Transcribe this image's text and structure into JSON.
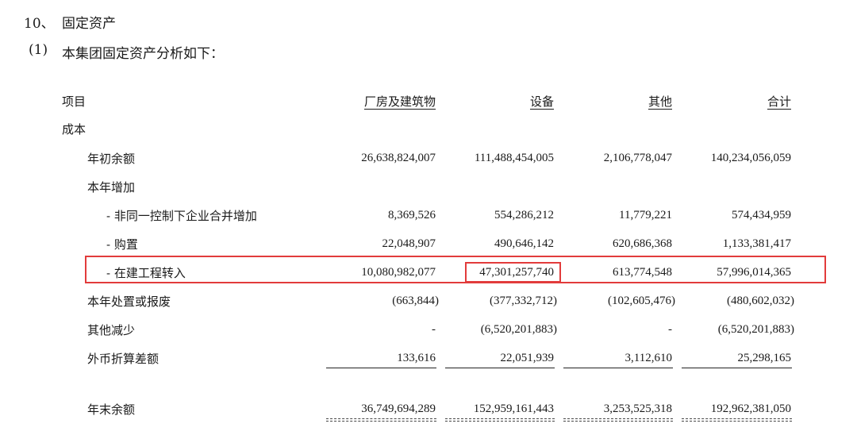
{
  "section": {
    "number": "10、",
    "title": "固定资产",
    "sub_number": "(1)",
    "sub_title": "本集团固定资产分析如下："
  },
  "table": {
    "headers": {
      "item": "项目",
      "col1": "厂房及建筑物",
      "col2": "设备",
      "col3": "其他",
      "col4": "合计"
    },
    "rows": [
      {
        "label": "成本",
        "values": [
          "",
          "",
          "",
          ""
        ]
      },
      {
        "label": "年初余额",
        "values": [
          "26,638,824,007",
          "111,488,454,005",
          "2,106,778,047",
          "140,234,056,059"
        ]
      },
      {
        "label": "本年增加",
        "values": [
          "",
          "",
          "",
          ""
        ]
      },
      {
        "label": "- 非同一控制下企业合并增加",
        "values": [
          "8,369,526",
          "554,286,212",
          "11,779,221",
          "574,434,959"
        ]
      },
      {
        "label": "- 购置",
        "values": [
          "22,048,907",
          "490,646,142",
          "620,686,368",
          "1,133,381,417"
        ]
      },
      {
        "label": "- 在建工程转入",
        "values": [
          "10,080,982,077",
          "47,301,257,740",
          "613,774,548",
          "57,996,014,365"
        ]
      },
      {
        "label": "本年处置或报废",
        "values": [
          "(663,844)",
          "(377,332,712)",
          "(102,605,476)",
          "(480,602,032)"
        ]
      },
      {
        "label": "其他减少",
        "values": [
          "-",
          "(6,520,201,883)",
          "-",
          "(6,520,201,883)"
        ]
      },
      {
        "label": "外币折算差额",
        "values": [
          "133,616",
          "22,051,939",
          "3,112,610",
          "25,298,165"
        ]
      },
      {
        "label": "年末余额",
        "values": [
          "36,749,694,289",
          "152,959,161,443",
          "3,253,525,318",
          "192,962,381,050"
        ]
      }
    ]
  },
  "highlight_color": "#e23b3b"
}
